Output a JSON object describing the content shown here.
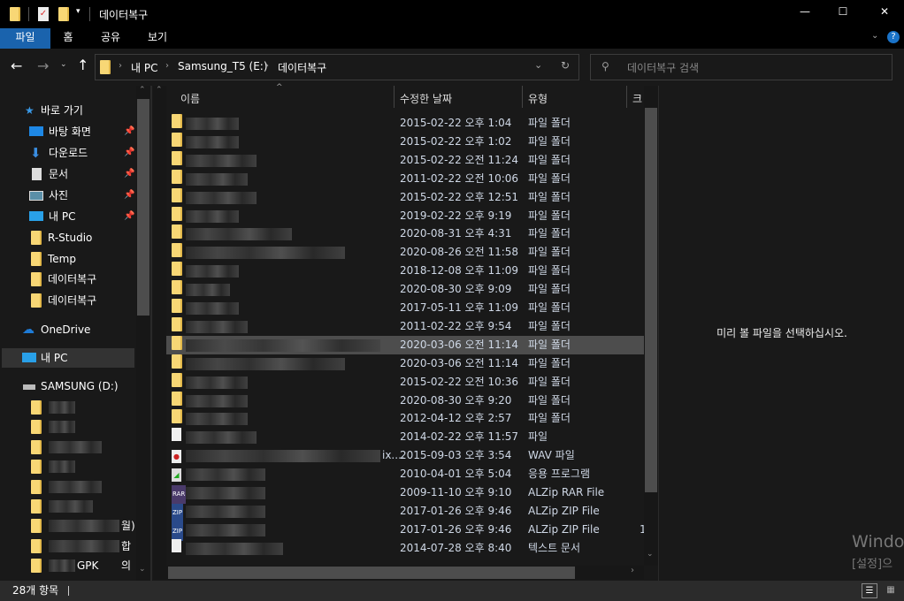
{
  "window": {
    "title": "데이터복구",
    "minimize": "—",
    "maximize": "☐",
    "close": "✕"
  },
  "ribbon": {
    "tabs": [
      "파일",
      "홈",
      "공유",
      "보기"
    ],
    "help": "?"
  },
  "address": {
    "crumbs": [
      "내 PC",
      "Samsung_T5 (E:)",
      "데이터복구"
    ],
    "search_placeholder": "데이터복구 검색"
  },
  "columns": {
    "name": "이름",
    "date": "수정한 날짜",
    "type": "유형",
    "size": "크"
  },
  "sidebar": {
    "quick_access": "바로 가기",
    "pinned": [
      {
        "label": "바탕 화면",
        "icon": "desktop-icon"
      },
      {
        "label": "다운로드",
        "icon": "download-icon"
      },
      {
        "label": "문서",
        "icon": "document-icon"
      },
      {
        "label": "사진",
        "icon": "pictures-icon"
      },
      {
        "label": "내 PC",
        "icon": "pc-icon"
      }
    ],
    "folders": [
      "R-Studio",
      "Temp",
      "데이터복구",
      "데이터복구"
    ],
    "onedrive": "OneDrive",
    "this_pc": "내 PC",
    "drive": "SAMSUNG (D:)",
    "drive_items": [
      "",
      "",
      "",
      "",
      "",
      "",
      "월)",
      "합의",
      "GPK"
    ]
  },
  "files": [
    {
      "date": "2015-02-22 오후 1:04",
      "type": "파일 폴더",
      "icon": "folder"
    },
    {
      "date": "2015-02-22 오후 1:02",
      "type": "파일 폴더",
      "icon": "folder"
    },
    {
      "date": "2015-02-22 오전 11:24",
      "type": "파일 폴더",
      "icon": "folder"
    },
    {
      "date": "2011-02-22 오전 10:06",
      "type": "파일 폴더",
      "icon": "folder"
    },
    {
      "date": "2015-02-22 오후 12:51",
      "type": "파일 폴더",
      "icon": "folder"
    },
    {
      "date": "2019-02-22 오후 9:19",
      "type": "파일 폴더",
      "icon": "folder"
    },
    {
      "date": "2020-08-31 오후 4:31",
      "type": "파일 폴더",
      "icon": "folder"
    },
    {
      "date": "2020-08-26 오전 11:58",
      "type": "파일 폴더",
      "icon": "folder"
    },
    {
      "date": "2018-12-08 오후 11:09",
      "type": "파일 폴더",
      "icon": "folder"
    },
    {
      "date": "2020-08-30 오후 9:09",
      "type": "파일 폴더",
      "icon": "folder"
    },
    {
      "date": "2017-05-11 오후 11:09",
      "type": "파일 폴더",
      "icon": "folder"
    },
    {
      "date": "2011-02-22 오후 9:54",
      "type": "파일 폴더",
      "icon": "folder"
    },
    {
      "date": "2020-03-06 오전 11:14",
      "type": "파일 폴더",
      "icon": "folder",
      "selected": true
    },
    {
      "date": "2020-03-06 오전 11:14",
      "type": "파일 폴더",
      "icon": "folder"
    },
    {
      "date": "2015-02-22 오전 10:36",
      "type": "파일 폴더",
      "icon": "folder"
    },
    {
      "date": "2020-08-30 오후 9:20",
      "type": "파일 폴더",
      "icon": "folder"
    },
    {
      "date": "2012-04-12 오후 2:57",
      "type": "파일 폴더",
      "icon": "folder"
    },
    {
      "date": "2014-02-22 오후 11:57",
      "type": "파일",
      "icon": "file"
    },
    {
      "date": "2015-09-03 오후 3:54",
      "type": "WAV 파일",
      "icon": "wav",
      "name_suffix": "ix...."
    },
    {
      "date": "2010-04-01 오후 5:04",
      "type": "응용 프로그램",
      "icon": "exe"
    },
    {
      "date": "2009-11-10 오후 9:10",
      "type": "ALZip RAR File",
      "icon": "rar"
    },
    {
      "date": "2017-01-26 오후 9:46",
      "type": "ALZip ZIP File",
      "icon": "zip"
    },
    {
      "date": "2017-01-26 오후 9:46",
      "type": "ALZip ZIP File",
      "icon": "zip",
      "size": "1"
    },
    {
      "date": "2014-07-28 오후 8:40",
      "type": "텍스트 문서",
      "icon": "txt"
    }
  ],
  "preview": {
    "message": "미리 볼 파일을 선택하십시오."
  },
  "watermark": {
    "line1": "Windo",
    "line2": "[설정]으"
  },
  "status": {
    "count": "28개 항목"
  }
}
